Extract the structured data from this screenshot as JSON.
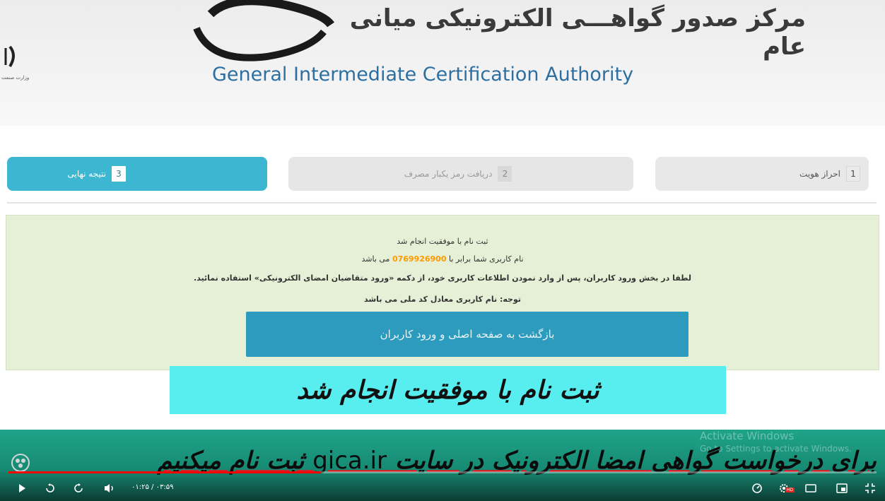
{
  "header": {
    "fa_title": "مرکز صدور گواهـــی الکترونیکی میانی عام",
    "en_title": "General Intermediate Certification Authority",
    "logo_text": "وزارت صنعت"
  },
  "steps": [
    {
      "num": "1",
      "label": "احراز هویت"
    },
    {
      "num": "2",
      "label": "دریافت رمز یکبار مصرف"
    },
    {
      "num": "3",
      "label": "نتیجه نهایی"
    }
  ],
  "result": {
    "line1": "ثبت نام با موفقیت انجام شد",
    "line2_prefix": "نام کاربری شما برابر با",
    "username": "0769926900",
    "line2_suffix": "می باشد",
    "line3": "لطفا در بخش ورود کاربران، پس از وارد نمودن اطلاعات کاربری خود، از دکمه «ورود متقاضیان امضای الکترونیکی» استفاده نمائید.",
    "line4": "توجه: نام کاربری معادل کد ملی می باشد",
    "back_button": "بازگشت به صفحه اصلی و ورود کاربران"
  },
  "captions": {
    "success": "ثبت نام با موفقیت انجام شد",
    "bottom_before": "برای درخواست گواهی امضا الکترونیک در سایت",
    "bottom_latin": "gica.ir",
    "bottom_after": "ثبت نام میکنیم"
  },
  "watermark": {
    "line1": "Activate Windows",
    "line2": "Go to Settings to activate Windows."
  },
  "player": {
    "time": "۰۱:۲۵ / ۰۳:۵۹",
    "progress": 0.36,
    "hd_badge": "HD"
  },
  "colors": {
    "accent": "#3db6d1",
    "button": "#2d9bbd",
    "success_bg": "#e6f0d6",
    "caption_bg": "#58eef0",
    "progress": "#ff0000"
  }
}
